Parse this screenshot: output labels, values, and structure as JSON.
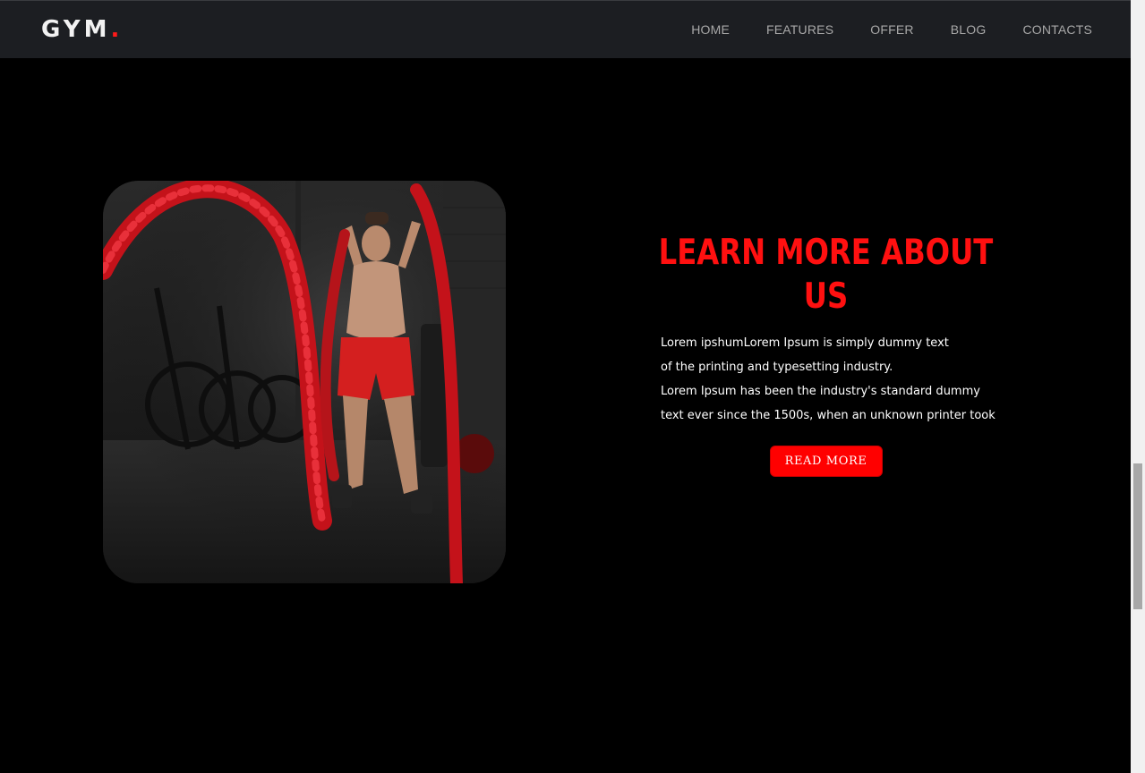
{
  "brand": {
    "name": "GYM",
    "dot": ".",
    "accent_color": "#ff1a1a"
  },
  "nav": {
    "items": [
      {
        "label": "HOME"
      },
      {
        "label": "FEATURES"
      },
      {
        "label": "OFFER"
      },
      {
        "label": "BLOG"
      },
      {
        "label": "CONTACTS"
      }
    ]
  },
  "about": {
    "heading_line1": "LEARN MORE ABOUT",
    "heading_line2": "US",
    "body_lines": [
      "Lorem ipshumLorem Ipsum is simply dummy text",
      "of the printing and typesetting industry.",
      "Lorem Ipsum has been the industry's standard dummy",
      "text ever since the 1500s, when an unknown printer took"
    ],
    "button_label": "READ MORE"
  },
  "hero_image": {
    "subject": "man training with battle ropes in dark gym"
  },
  "colors": {
    "background": "#000000",
    "header": "#1c1e22",
    "heading": "#ff1010",
    "button": "#ff0000"
  }
}
